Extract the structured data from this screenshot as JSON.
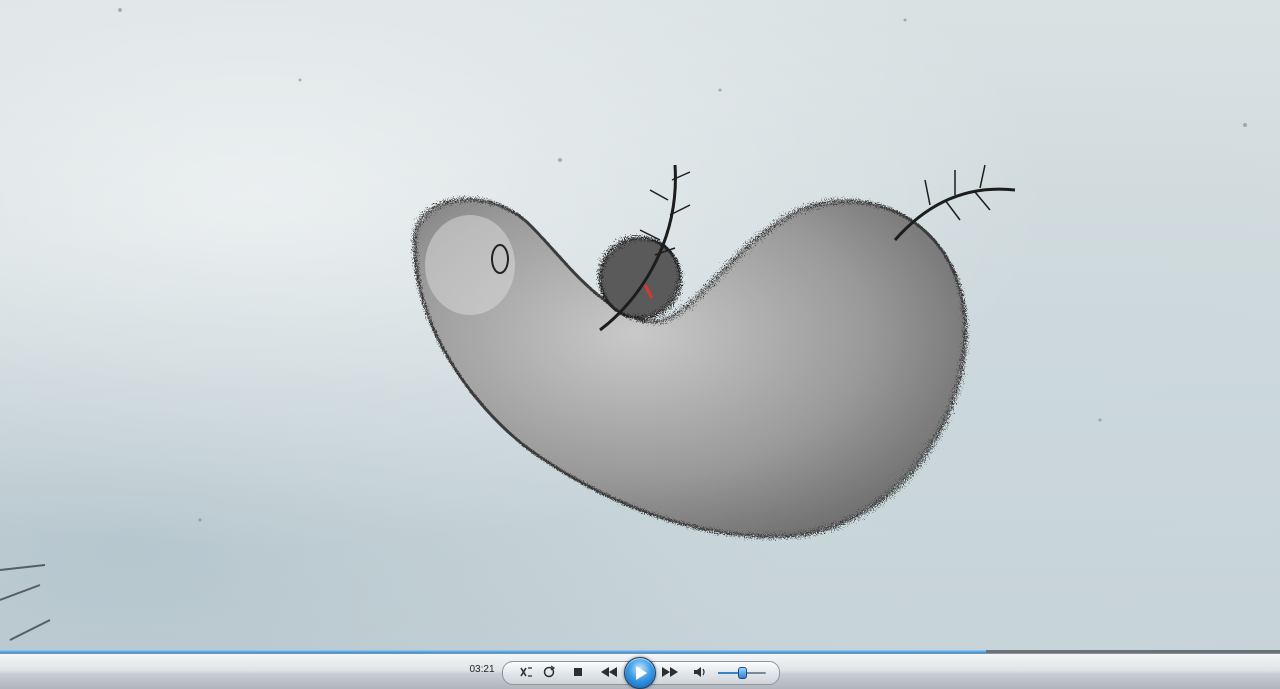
{
  "player": {
    "time_elapsed": "03:21",
    "progress_fraction": 0.77,
    "volume_fraction": 0.5,
    "accent_color": "#2f8fe0"
  },
  "controls": {
    "shuffle_icon": "shuffle-icon",
    "repeat_icon": "repeat-icon",
    "stop_icon": "stop-icon",
    "previous_icon": "rewind-icon",
    "play_icon": "play-icon",
    "next_icon": "fast-forward-icon",
    "mute_icon": "speaker-icon"
  }
}
